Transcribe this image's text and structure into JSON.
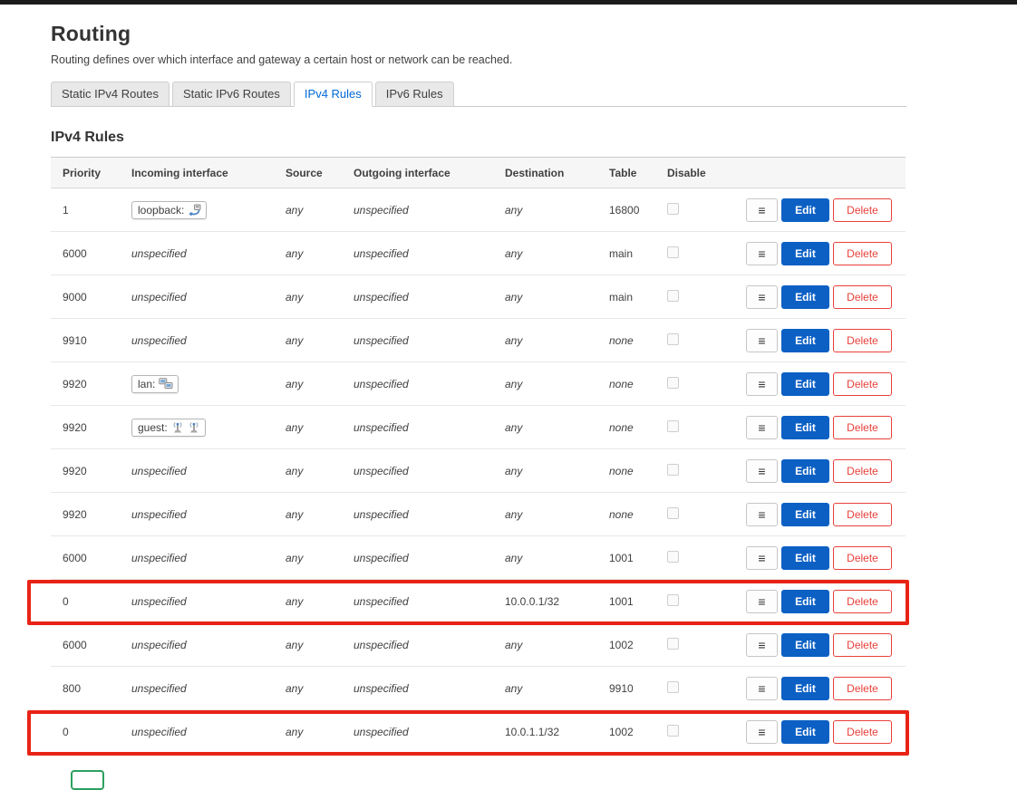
{
  "page": {
    "title": "Routing",
    "description": "Routing defines over which interface and gateway a certain host or network can be reached.",
    "section_title": "IPv4 Rules"
  },
  "tabs": [
    {
      "id": "static-ipv4-routes",
      "label": "Static IPv4 Routes",
      "active": false
    },
    {
      "id": "static-ipv6-routes",
      "label": "Static IPv6 Routes",
      "active": false
    },
    {
      "id": "ipv4-rules",
      "label": "IPv4 Rules",
      "active": true
    },
    {
      "id": "ipv6-rules",
      "label": "IPv6 Rules",
      "active": false
    }
  ],
  "table": {
    "columns": [
      "Priority",
      "Incoming interface",
      "Source",
      "Outgoing interface",
      "Destination",
      "Table",
      "Disable"
    ],
    "actions": {
      "menu_icon": "hamburger-menu-icon",
      "edit": "Edit",
      "delete": "Delete"
    },
    "rows": [
      {
        "priority": "1",
        "incoming": {
          "kind": "badge",
          "label": "loopback:",
          "icons": [
            "loopback-icon"
          ]
        },
        "source": {
          "text": "any",
          "italic": true
        },
        "outgoing": {
          "text": "unspecified",
          "italic": true
        },
        "destination": {
          "text": "any",
          "italic": true
        },
        "table": {
          "text": "16800",
          "italic": false
        },
        "disabled": false,
        "highlight": false
      },
      {
        "priority": "6000",
        "incoming": {
          "kind": "text",
          "text": "unspecified",
          "italic": true
        },
        "source": {
          "text": "any",
          "italic": true
        },
        "outgoing": {
          "text": "unspecified",
          "italic": true
        },
        "destination": {
          "text": "any",
          "italic": true
        },
        "table": {
          "text": "main",
          "italic": false
        },
        "disabled": false,
        "highlight": false
      },
      {
        "priority": "9000",
        "incoming": {
          "kind": "text",
          "text": "unspecified",
          "italic": true
        },
        "source": {
          "text": "any",
          "italic": true
        },
        "outgoing": {
          "text": "unspecified",
          "italic": true
        },
        "destination": {
          "text": "any",
          "italic": true
        },
        "table": {
          "text": "main",
          "italic": false
        },
        "disabled": false,
        "highlight": false
      },
      {
        "priority": "9910",
        "incoming": {
          "kind": "text",
          "text": "unspecified",
          "italic": true
        },
        "source": {
          "text": "any",
          "italic": true
        },
        "outgoing": {
          "text": "unspecified",
          "italic": true
        },
        "destination": {
          "text": "any",
          "italic": true
        },
        "table": {
          "text": "none",
          "italic": true
        },
        "disabled": false,
        "highlight": false
      },
      {
        "priority": "9920",
        "incoming": {
          "kind": "badge",
          "label": "lan:",
          "icons": [
            "ethernet-icon"
          ]
        },
        "source": {
          "text": "any",
          "italic": true
        },
        "outgoing": {
          "text": "unspecified",
          "italic": true
        },
        "destination": {
          "text": "any",
          "italic": true
        },
        "table": {
          "text": "none",
          "italic": true
        },
        "disabled": false,
        "highlight": false
      },
      {
        "priority": "9920",
        "incoming": {
          "kind": "badge",
          "label": "guest:",
          "icons": [
            "wifi-icon",
            "wifi-icon"
          ]
        },
        "source": {
          "text": "any",
          "italic": true
        },
        "outgoing": {
          "text": "unspecified",
          "italic": true
        },
        "destination": {
          "text": "any",
          "italic": true
        },
        "table": {
          "text": "none",
          "italic": true
        },
        "disabled": false,
        "highlight": false
      },
      {
        "priority": "9920",
        "incoming": {
          "kind": "text",
          "text": "unspecified",
          "italic": true
        },
        "source": {
          "text": "any",
          "italic": true
        },
        "outgoing": {
          "text": "unspecified",
          "italic": true
        },
        "destination": {
          "text": "any",
          "italic": true
        },
        "table": {
          "text": "none",
          "italic": true
        },
        "disabled": false,
        "highlight": false
      },
      {
        "priority": "9920",
        "incoming": {
          "kind": "text",
          "text": "unspecified",
          "italic": true
        },
        "source": {
          "text": "any",
          "italic": true
        },
        "outgoing": {
          "text": "unspecified",
          "italic": true
        },
        "destination": {
          "text": "any",
          "italic": true
        },
        "table": {
          "text": "none",
          "italic": true
        },
        "disabled": false,
        "highlight": false
      },
      {
        "priority": "6000",
        "incoming": {
          "kind": "text",
          "text": "unspecified",
          "italic": true
        },
        "source": {
          "text": "any",
          "italic": true
        },
        "outgoing": {
          "text": "unspecified",
          "italic": true
        },
        "destination": {
          "text": "any",
          "italic": true
        },
        "table": {
          "text": "1001",
          "italic": false
        },
        "disabled": false,
        "highlight": false
      },
      {
        "priority": "0",
        "incoming": {
          "kind": "text",
          "text": "unspecified",
          "italic": true
        },
        "source": {
          "text": "any",
          "italic": true
        },
        "outgoing": {
          "text": "unspecified",
          "italic": true
        },
        "destination": {
          "text": "10.0.0.1/32",
          "italic": false
        },
        "table": {
          "text": "1001",
          "italic": false
        },
        "disabled": false,
        "highlight": true
      },
      {
        "priority": "6000",
        "incoming": {
          "kind": "text",
          "text": "unspecified",
          "italic": true
        },
        "source": {
          "text": "any",
          "italic": true
        },
        "outgoing": {
          "text": "unspecified",
          "italic": true
        },
        "destination": {
          "text": "any",
          "italic": true
        },
        "table": {
          "text": "1002",
          "italic": false
        },
        "disabled": false,
        "highlight": false
      },
      {
        "priority": "800",
        "incoming": {
          "kind": "text",
          "text": "unspecified",
          "italic": true
        },
        "source": {
          "text": "any",
          "italic": true
        },
        "outgoing": {
          "text": "unspecified",
          "italic": true
        },
        "destination": {
          "text": "any",
          "italic": true
        },
        "table": {
          "text": "9910",
          "italic": false
        },
        "disabled": false,
        "highlight": false
      },
      {
        "priority": "0",
        "incoming": {
          "kind": "text",
          "text": "unspecified",
          "italic": true
        },
        "source": {
          "text": "any",
          "italic": true
        },
        "outgoing": {
          "text": "unspecified",
          "italic": true
        },
        "destination": {
          "text": "10.0.1.1/32",
          "italic": false
        },
        "table": {
          "text": "1002",
          "italic": false
        },
        "disabled": false,
        "highlight": true
      }
    ]
  },
  "colors": {
    "edit_button_bg": "#0c60c4",
    "delete_button_red": "#e9403a",
    "highlight_red": "#e82315",
    "active_tab_blue": "#0069d6",
    "add_button_green": "#2ca05f",
    "topbar": "#1b1b1b"
  }
}
